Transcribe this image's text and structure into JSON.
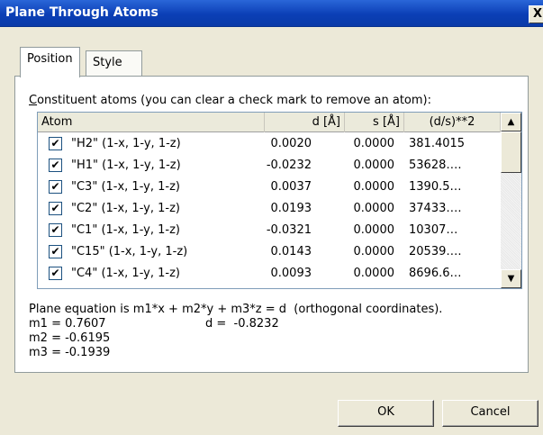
{
  "window": {
    "title": "Plane Through Atoms",
    "close_glyph": "X"
  },
  "tabs": [
    {
      "label": "Position",
      "active": true
    },
    {
      "label": "Style",
      "active": false
    }
  ],
  "list": {
    "caption_accel": "C",
    "caption_rest": "onstituent atoms (you can clear a check mark to remove an atom):",
    "columns": [
      "Atom",
      "d [Å]",
      "s [Å]",
      "(d/s)**2"
    ],
    "rows": [
      {
        "atom": "\"H2\" (1-x, 1-y, 1-z)",
        "d": "0.0020",
        "s": "0.0000",
        "ratio": "381.4015",
        "checked": true
      },
      {
        "atom": "\"H1\" (1-x, 1-y, 1-z)",
        "d": "-0.0232",
        "s": "0.0000",
        "ratio": "53628….",
        "checked": true
      },
      {
        "atom": "\"C3\" (1-x, 1-y, 1-z)",
        "d": "0.0037",
        "s": "0.0000",
        "ratio": "1390.5…",
        "checked": true
      },
      {
        "atom": "\"C2\" (1-x, 1-y, 1-z)",
        "d": "0.0193",
        "s": "0.0000",
        "ratio": "37433….",
        "checked": true
      },
      {
        "atom": "\"C1\" (1-x, 1-y, 1-z)",
        "d": "-0.0321",
        "s": "0.0000",
        "ratio": "10307…",
        "checked": true
      },
      {
        "atom": "\"C15\" (1-x, 1-y, 1-z)",
        "d": "0.0143",
        "s": "0.0000",
        "ratio": "20539….",
        "checked": true
      },
      {
        "atom": "\"C4\" (1-x, 1-y, 1-z)",
        "d": "0.0093",
        "s": "0.0000",
        "ratio": "8696.6…",
        "checked": true
      }
    ]
  },
  "equation": {
    "line1": "Plane equation is m1*x + m2*y + m3*z = d  (orthogonal coordinates).",
    "m1": "m1 = 0.7607",
    "d": "d =  -0.8232",
    "m2": "m2 = -0.6195",
    "m3": "m3 = -0.1939"
  },
  "buttons": {
    "ok": "OK",
    "cancel": "Cancel"
  },
  "icons": {
    "scroll_up": "up-arrow-icon",
    "scroll_down": "down-arrow-icon",
    "check": "check-icon"
  },
  "colors": {
    "titlebar": "#0b3fb6",
    "dialog": "#ece9d8"
  }
}
